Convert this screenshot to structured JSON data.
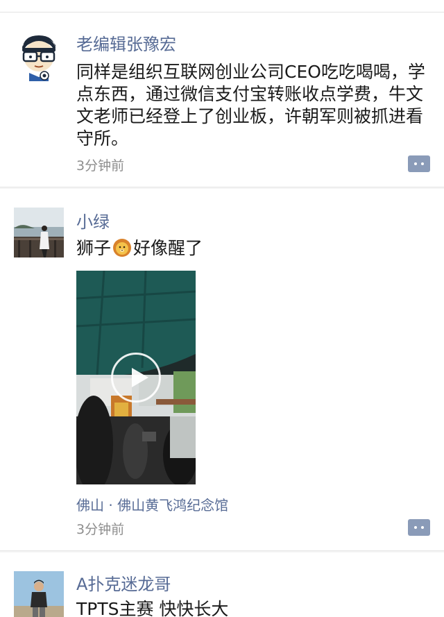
{
  "posts": [
    {
      "name": "老编辑张豫宏",
      "text": "同样是组织互联网创业公司CEO吃吃喝喝，学点东西，通过微信支付宝转账收点学费，牛文文老师已经登上了创业板，许朝军则被抓进看守所。",
      "time": "3分钟前",
      "avatar_icon": "cartoon-glasses-avatar"
    },
    {
      "name": "小绿",
      "text_before": "狮子",
      "emoji": "lion-face-emoji",
      "text_after": "好像醒了",
      "location": "佛山 · 佛山黄飞鸿纪念馆",
      "time": "3分钟前",
      "avatar_icon": "lakeside-photo-avatar"
    },
    {
      "name": "A扑克迷龙哥",
      "text": "TPTS主赛 快快长大",
      "avatar_icon": "man-portrait-avatar"
    }
  ],
  "colors": {
    "name": "#576b95",
    "time": "#8d8d8d",
    "comment_button": "#8a9bb8"
  }
}
